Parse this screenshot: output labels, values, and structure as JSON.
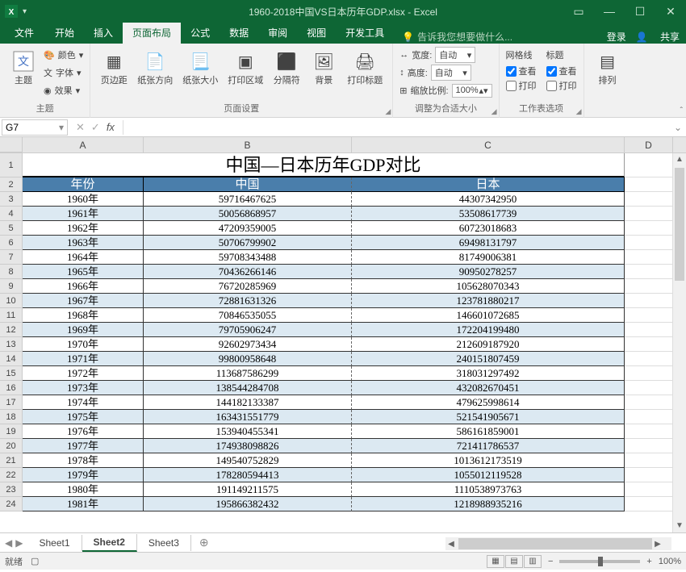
{
  "titlebar": {
    "title": "1960-2018中国VS日本历年GDP.xlsx - Excel"
  },
  "tabs": {
    "file": "文件",
    "home": "开始",
    "insert": "插入",
    "layout": "页面布局",
    "formulas": "公式",
    "data": "数据",
    "review": "审阅",
    "view": "视图",
    "developer": "开发工具",
    "tellme": "告诉我您想要做什么...",
    "login": "登录",
    "share": "共享"
  },
  "ribbon": {
    "theme": {
      "btn": "主题",
      "colors": "颜色",
      "fonts": "字体",
      "effects": "效果",
      "group": "主题"
    },
    "page": {
      "margins": "页边距",
      "orientation": "纸张方向",
      "size": "纸张大小",
      "printarea": "打印区域",
      "breaks": "分隔符",
      "background": "背景",
      "titles": "打印标题",
      "group": "页面设置"
    },
    "scale": {
      "width": "宽度:",
      "height": "高度:",
      "scale": "缩放比例:",
      "auto": "自动",
      "pct": "100%",
      "group": "调整为合适大小"
    },
    "sheet": {
      "gridlines": "网格线",
      "headings": "标题",
      "view": "查看",
      "print": "打印",
      "group": "工作表选项"
    },
    "arrange": {
      "btn": "排列"
    }
  },
  "formula": {
    "cell": "G7",
    "fx": "fx"
  },
  "cols": {
    "A": "A",
    "B": "B",
    "C": "C",
    "D": "D"
  },
  "table": {
    "title": "中国—日本历年GDP对比",
    "headers": [
      "年份",
      "中国",
      "日本"
    ],
    "rows": [
      [
        "1960年",
        "59716467625",
        "44307342950"
      ],
      [
        "1961年",
        "50056868957",
        "53508617739"
      ],
      [
        "1962年",
        "47209359005",
        "60723018683"
      ],
      [
        "1963年",
        "50706799902",
        "69498131797"
      ],
      [
        "1964年",
        "59708343488",
        "81749006381"
      ],
      [
        "1965年",
        "70436266146",
        "90950278257"
      ],
      [
        "1966年",
        "76720285969",
        "105628070343"
      ],
      [
        "1967年",
        "72881631326",
        "123781880217"
      ],
      [
        "1968年",
        "70846535055",
        "146601072685"
      ],
      [
        "1969年",
        "79705906247",
        "172204199480"
      ],
      [
        "1970年",
        "92602973434",
        "212609187920"
      ],
      [
        "1971年",
        "99800958648",
        "240151807459"
      ],
      [
        "1972年",
        "113687586299",
        "318031297492"
      ],
      [
        "1973年",
        "138544284708",
        "432082670451"
      ],
      [
        "1974年",
        "144182133387",
        "479625998614"
      ],
      [
        "1975年",
        "163431551779",
        "521541905671"
      ],
      [
        "1976年",
        "153940455341",
        "586161859001"
      ],
      [
        "1977年",
        "174938098826",
        "721411786537"
      ],
      [
        "1978年",
        "149540752829",
        "1013612173519"
      ],
      [
        "1979年",
        "178280594413",
        "1055012119528"
      ],
      [
        "1980年",
        "191149211575",
        "1110538973763"
      ],
      [
        "1981年",
        "195866382432",
        "1218988935216"
      ]
    ]
  },
  "sheets": {
    "s1": "Sheet1",
    "s2": "Sheet2",
    "s3": "Sheet3"
  },
  "status": {
    "ready": "就绪",
    "rec": "",
    "zoom": "100%"
  }
}
